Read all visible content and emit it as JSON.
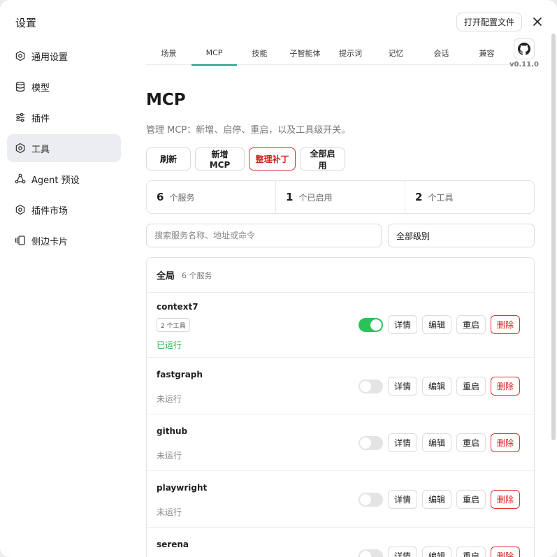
{
  "window": {
    "title": "设置",
    "open_config_label": "打开配置文件"
  },
  "sidebar": {
    "items": [
      {
        "label": "通用设置",
        "icon": "gear-icon"
      },
      {
        "label": "模型",
        "icon": "database-icon"
      },
      {
        "label": "插件",
        "icon": "sliders-icon"
      },
      {
        "label": "工具",
        "icon": "gear-icon",
        "active": true
      },
      {
        "label": "Agent 预设",
        "icon": "agent-icon"
      },
      {
        "label": "插件市场",
        "icon": "gear-icon"
      },
      {
        "label": "侧边卡片",
        "icon": "cards-icon"
      }
    ]
  },
  "tabs": [
    {
      "label": "场景"
    },
    {
      "label": "MCP",
      "active": true
    },
    {
      "label": "技能"
    },
    {
      "label": "子智能体"
    },
    {
      "label": "提示词"
    },
    {
      "label": "记忆"
    },
    {
      "label": "会话"
    },
    {
      "label": "兼容"
    }
  ],
  "version": "v0.11.0",
  "main": {
    "title": "MCP",
    "description": "管理 MCP：新增、启停、重启，以及工具级开关。",
    "actions": {
      "refresh": "刷新",
      "add": "新增 MCP",
      "patch": "整理补丁",
      "enable_all": "全部启用"
    },
    "stats": [
      {
        "num": "6",
        "label": "个服务"
      },
      {
        "num": "1",
        "label": "个已启用"
      },
      {
        "num": "2",
        "label": "个工具"
      }
    ],
    "search_placeholder": "搜索服务名称、地址或命令",
    "level_selected": "全部级别",
    "group": {
      "title": "全局",
      "count": "6 个服务",
      "services": [
        {
          "name": "context7",
          "tools": "2 个工具",
          "status": "已运行",
          "enabled": true
        },
        {
          "name": "fastgraph",
          "status": "未运行",
          "enabled": false
        },
        {
          "name": "github",
          "status": "未运行",
          "enabled": false
        },
        {
          "name": "playwright",
          "status": "未运行",
          "enabled": false
        },
        {
          "name": "serena",
          "status": "",
          "enabled": false
        }
      ]
    },
    "row_buttons": {
      "detail": "详情",
      "edit": "编辑",
      "restart": "重启",
      "delete": "删除"
    }
  },
  "colors": {
    "accent": "#1e9e8a",
    "danger": "#e03131",
    "toggle_on": "#2bc259",
    "running": "#2bb24c"
  }
}
